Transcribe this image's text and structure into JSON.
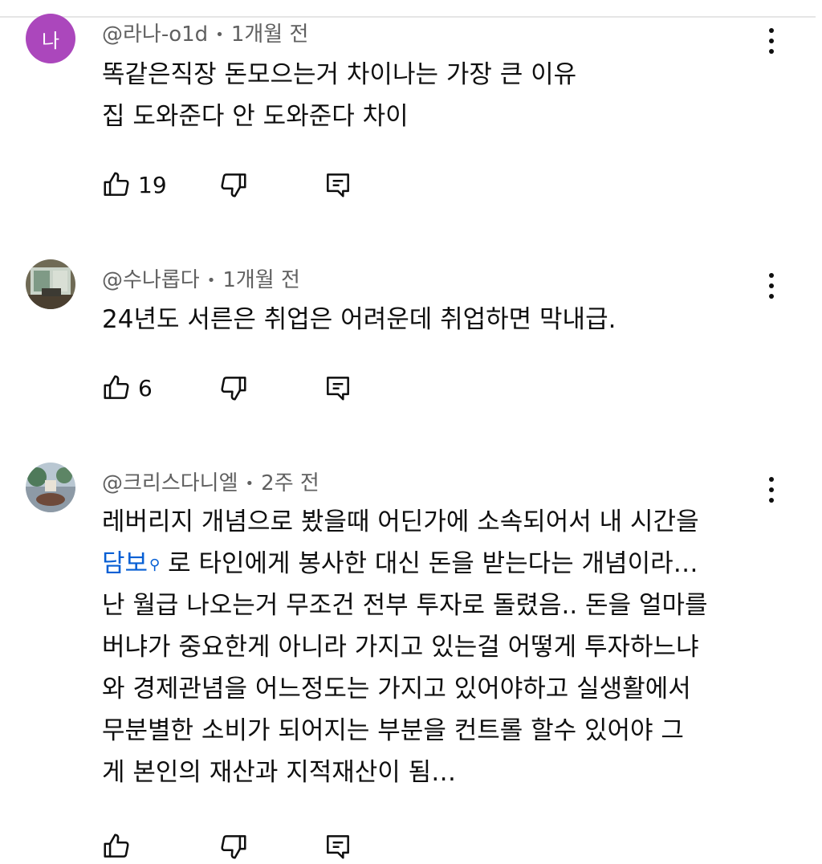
{
  "comments": [
    {
      "avatar_letter": "나",
      "author": "@라나-o1d",
      "time": "1개월 전",
      "lines": [
        "똑같은직장 돈모으는거 차이나는 가장 큰 이유",
        "집 도와준다 안 도와준다 차이"
      ],
      "likes": "19"
    },
    {
      "author": "@수나롭다",
      "time": "1개월 전",
      "lines": [
        "24년도 서른은 취업은 어려운데 취업하면 막내급."
      ],
      "likes": "6"
    },
    {
      "author": "@크리스다니엘",
      "time": "2주 전",
      "lines": [
        "레버리지 개념으로 봤을때 어딘가에 소속되어서 내 시간을",
        "로 타인에게 봉사한 대신 돈을 받는다는 개념이라…",
        "난 월급 나오는거 무조건 전부 투자로 돌렸음.. 돈을 얼마를",
        "버냐가 중요한게 아니라 가지고 있는걸 어떻게 투자하느냐",
        "와 경제관념을 어느정도는 가지고 있어야하고 실생활에서",
        "무분별한 소비가 되어지는 부분을 컨트롤 할수 있어야 그",
        "게 본인의 재산과 지적재산이 됨…"
      ],
      "link_text": "담보",
      "likes": ""
    }
  ],
  "colors": {
    "avatar_bg": "#ab47bc",
    "link": "#065fd4",
    "meta": "#606060"
  },
  "icons": [
    "like-icon",
    "dislike-icon",
    "reply-icon",
    "more-vert-icon",
    "search-icon"
  ]
}
